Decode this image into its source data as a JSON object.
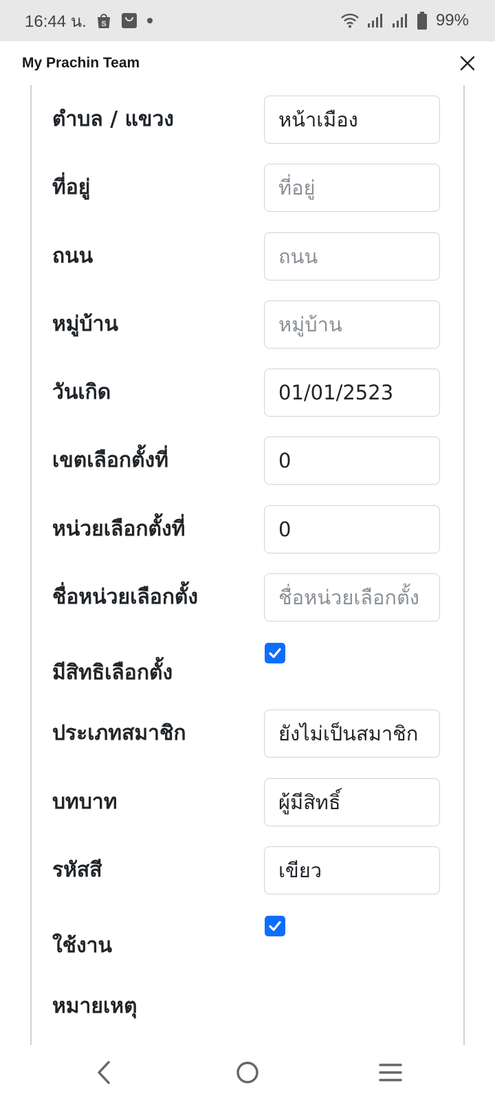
{
  "status_bar": {
    "time": "16:44 น.",
    "battery": "99%",
    "icons": [
      "shopee-icon",
      "shopping-bag-icon",
      "dot-icon",
      "wifi-icon",
      "signal-icon",
      "signal-icon",
      "battery-icon"
    ]
  },
  "header": {
    "title": "My Prachin Team"
  },
  "form": {
    "subdistrict": {
      "label": "ตำบล / แขวง",
      "value": "หน้าเมือง",
      "placeholder": ""
    },
    "address": {
      "label": "ที่อยู่",
      "value": "",
      "placeholder": "ที่อยู่"
    },
    "road": {
      "label": "ถนน",
      "value": "",
      "placeholder": "ถนน"
    },
    "village": {
      "label": "หมู่บ้าน",
      "value": "",
      "placeholder": "หมู่บ้าน"
    },
    "birthdate": {
      "label": "วันเกิด",
      "value": "01/01/2523",
      "placeholder": ""
    },
    "district_no": {
      "label": "เขตเลือกตั้งที่",
      "value": "0",
      "placeholder": ""
    },
    "unit_no": {
      "label": "หน่วยเลือกตั้งที่",
      "value": "0",
      "placeholder": ""
    },
    "unit_name": {
      "label": "ชื่อหน่วยเลือกตั้ง",
      "value": "",
      "placeholder": "ชื่อหน่วยเลือกตั้ง"
    },
    "voting_right": {
      "label": "มีสิทธิเลือกตั้ง",
      "checked": true
    },
    "member_type": {
      "label": "ประเภทสมาชิก",
      "value": "ยังไม่เป็นสมาชิก"
    },
    "role": {
      "label": "บทบาท",
      "value": "ผู้มีสิทธิ์"
    },
    "color_code": {
      "label": "รหัสสี",
      "value": "เขียว"
    },
    "active": {
      "label": "ใช้งาน",
      "checked": true
    },
    "remark": {
      "label": "หมายเหตุ"
    }
  },
  "colors": {
    "accent": "#0d6efd",
    "status_bar_bg": "#e8e8e8"
  }
}
